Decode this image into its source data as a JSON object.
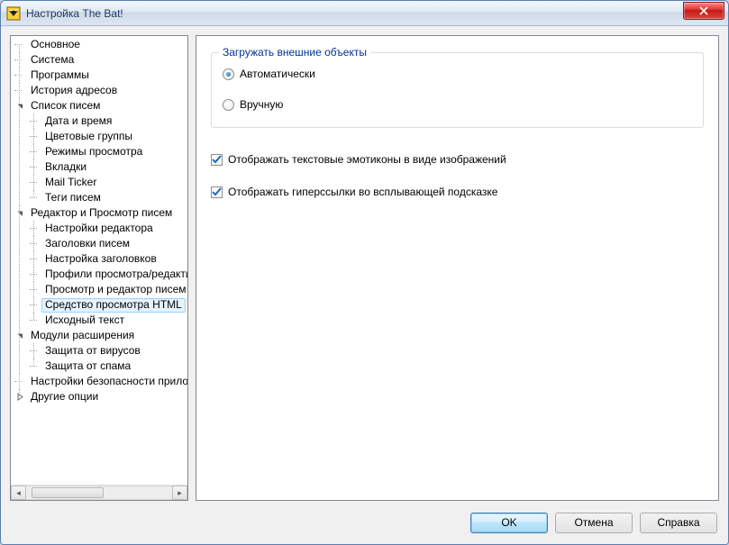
{
  "window": {
    "title": "Настройка The Bat!"
  },
  "tree": {
    "items": [
      {
        "label": "Основное",
        "type": "leaf"
      },
      {
        "label": "Система",
        "type": "leaf"
      },
      {
        "label": "Программы",
        "type": "leaf"
      },
      {
        "label": "История адресов",
        "type": "leaf"
      },
      {
        "label": "Список писем",
        "type": "expanded",
        "children": [
          {
            "label": "Дата и время"
          },
          {
            "label": "Цветовые группы"
          },
          {
            "label": "Режимы просмотра"
          },
          {
            "label": "Вкладки"
          },
          {
            "label": "Mail Ticker"
          },
          {
            "label": "Теги писем"
          }
        ]
      },
      {
        "label": "Редактор и Просмотр писем",
        "type": "expanded",
        "children": [
          {
            "label": "Настройки редактора"
          },
          {
            "label": "Заголовки писем"
          },
          {
            "label": "Настройка заголовков"
          },
          {
            "label": "Профили просмотра/редактирования"
          },
          {
            "label": "Просмотр и редактор писем"
          },
          {
            "label": "Средство просмотра HTML",
            "selected": true
          },
          {
            "label": "Исходный текст"
          }
        ]
      },
      {
        "label": "Модули расширения",
        "type": "expanded",
        "children": [
          {
            "label": "Защита от вирусов"
          },
          {
            "label": "Защита от спама"
          }
        ]
      },
      {
        "label": "Настройки безопасности приложения",
        "type": "leaf"
      },
      {
        "label": "Другие опции",
        "type": "collapsed"
      }
    ]
  },
  "settings": {
    "group_legend": "Загружать внешние объекты",
    "radio_auto": "Автоматически",
    "radio_manual": "Вручную",
    "radio_selected": "auto",
    "cb_emoticons": "Отображать текстовые эмотиконы в виде изображений",
    "cb_emoticons_checked": true,
    "cb_hyperlinks": "Отображать гиперссылки во всплывающей подсказке",
    "cb_hyperlinks_checked": true
  },
  "buttons": {
    "ok": "OK",
    "cancel": "Отмена",
    "help": "Справка"
  }
}
